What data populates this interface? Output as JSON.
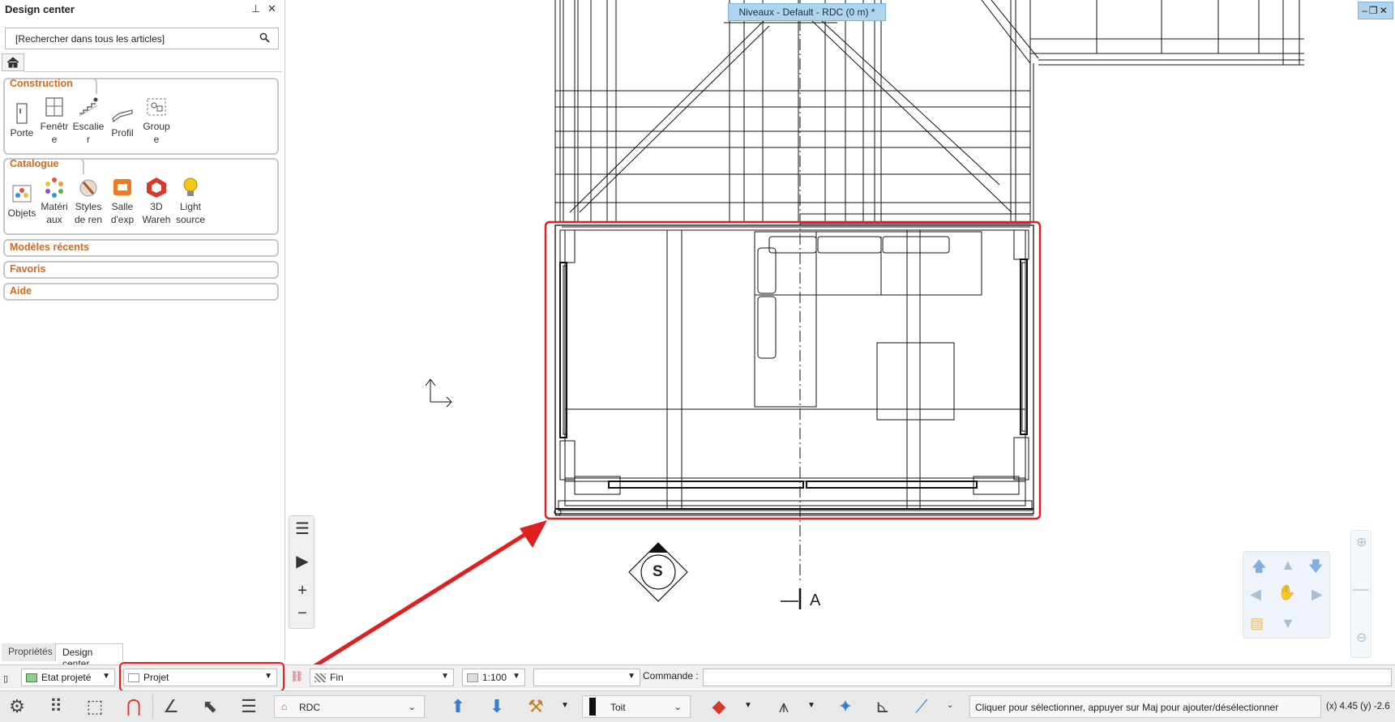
{
  "panel": {
    "title": "Design center",
    "search_placeholder": "[Rechercher dans tous les articles]",
    "groups": {
      "construction": {
        "title": "Construction",
        "items": [
          {
            "label_1": "Porte",
            "label_2": "",
            "icon": "door-icon"
          },
          {
            "label_1": "Fenêtr",
            "label_2": "e",
            "icon": "window-icon"
          },
          {
            "label_1": "Escalie",
            "label_2": "r",
            "icon": "stairs-icon"
          },
          {
            "label_1": "Profil",
            "label_2": "",
            "icon": "profile-icon"
          },
          {
            "label_1": "Group",
            "label_2": "e",
            "icon": "group-icon"
          }
        ]
      },
      "catalogue": {
        "title": "Catalogue",
        "items": [
          {
            "label_1": "Objets",
            "label_2": "",
            "icon": "objects-icon"
          },
          {
            "label_1": "Matéri",
            "label_2": "aux",
            "icon": "materials-icon"
          },
          {
            "label_1": "Styles",
            "label_2": "de ren",
            "icon": "render-styles-icon"
          },
          {
            "label_1": "Salle",
            "label_2": "d'exp",
            "icon": "showroom-icon"
          },
          {
            "label_1": "3D",
            "label_2": "Wareh",
            "icon": "3d-warehouse-icon"
          },
          {
            "label_1": "Light",
            "label_2": "source",
            "icon": "light-bulb-icon"
          }
        ]
      },
      "recent": {
        "title": "Modèles récents"
      },
      "favorites": {
        "title": "Favoris"
      },
      "help": {
        "title": "Aide"
      }
    },
    "tabs": {
      "properties": "Propriétés",
      "design_center": "Design center"
    }
  },
  "canvas": {
    "level_tab": "Niveaux - Default - RDC (0 m) *",
    "compass_label": "S",
    "section_label": "A"
  },
  "row1": {
    "state": "Etat projeté",
    "project": "Projet",
    "line_quality": "Fin",
    "scale": "1:100",
    "command_label": "Commande :",
    "command_value": ""
  },
  "row2": {
    "level": "RDC",
    "layer": "Toit",
    "status_message": "Cliquer pour sélectionner, appuyer sur Maj pour ajouter/désélectionner",
    "coords": "(x) 4.45   (y) -2.6"
  },
  "colors": {
    "accent_orange": "#d2691e",
    "highlight_red": "#e02020",
    "level_tab_blue": "#aed4f0"
  }
}
